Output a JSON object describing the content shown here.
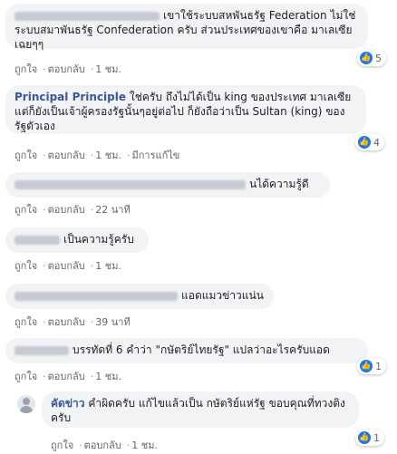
{
  "actions": {
    "like": "ถูกใจ",
    "reply": "ตอบกลับ",
    "edited": "มีการแก้ไข"
  },
  "comments": [
    {
      "name": "",
      "text": "เขาใช้ระบบสหพันธรัฐ Federation ไม่ใช่ระบบสมาพันธรัฐ Confederation ครับ ส่วนประเทศของเขาคือ มาเลเซีย เฉยๆๆ",
      "time": "1 ชม.",
      "reactions": "5"
    },
    {
      "name": "Principal Principle",
      "text": "ใช่ครับ ถึงไม่ได้เป็น king ของประเทศ มาเลเซีย แต่ก็ยังเป็นเจ้าผู้ครองรัฐนั้นๆอยู่ต่อไป ก็ยังถือว่าเป็น Sultan (king) ของ รัฐตัวเอง",
      "time": "1 ชม.",
      "reactions": "4"
    },
    {
      "name": "",
      "text": "นได้ความรู้ดี",
      "time": "22 นาที"
    },
    {
      "name": "",
      "text": "เป็นความรู้ครับ",
      "time": "1 ชม."
    },
    {
      "name": "",
      "text": "แอดแมวข่าวแน่น",
      "time": "39 นาที"
    },
    {
      "name": "",
      "text": "บรรทัดที่ 6 คำว่า \"กษัตริย์ไทยรัฐ\" แปลว่าอะไรครับแอด",
      "time": "1 ชม.",
      "reactions": "1"
    },
    {
      "name": "คัดข่าว",
      "text": "คำผิดครับ แก้ไขแล้วเป็น กษัตริย์แห่รัฐ ขอบคุณที่ทวงติงครับ",
      "time": "1 ชม.",
      "reactions": "1"
    }
  ],
  "colors": {
    "bubble": "#f2f3f5",
    "name": "#385898",
    "meta": "#606770",
    "like": "#1877f2"
  }
}
